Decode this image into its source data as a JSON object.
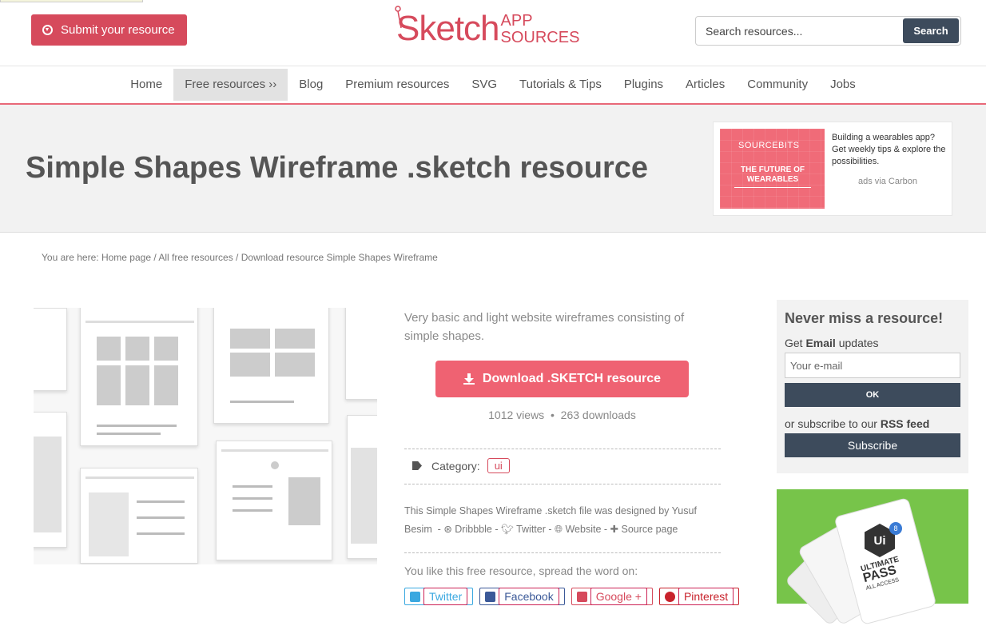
{
  "header": {
    "submit_label": "Submit your resource",
    "logo_main": "Sketch",
    "logo_app": "APP",
    "logo_sources": "SOURCES",
    "search_placeholder": "Search resources...",
    "search_button": "Search"
  },
  "nav": [
    "Home",
    "Free resources ››",
    "Blog",
    "Premium resources",
    "SVG",
    "Tutorials & Tips",
    "Plugins",
    "Articles",
    "Community",
    "Jobs"
  ],
  "hero": {
    "title": "Simple Shapes Wireframe .sketch resource",
    "ad": {
      "brand": "SOURCEBITS",
      "tagline": "THE FUTURE OF WEARABLES",
      "copy": "Building a wearables app? Get weekly tips & explore the possibilities.",
      "via": "ads via Carbon"
    }
  },
  "breadcrumb": {
    "prefix": "You are here: ",
    "home": "Home page",
    "sep1": " / ",
    "free": "All free resources",
    "sep2": " / ",
    "current": "Download resource Simple Shapes Wireframe"
  },
  "resource": {
    "description": "Very basic and light website wireframes consisting of simple shapes.",
    "download_label": "Download .SKETCH resource",
    "views": "1012 views",
    "dot": "•",
    "downloads": "263 downloads",
    "category_label": "Category:",
    "category_value": "ui",
    "credit_text": "This Simple Shapes Wireframe .sketch file was designed by Yusuf Besim",
    "credit_dribbble": "Dribbble",
    "credit_twitter": "Twitter",
    "credit_website": "Website",
    "credit_source": "Source page",
    "share_label": "You like this free resource, spread the word on:",
    "share": {
      "twitter": "Twitter",
      "facebook": "Facebook",
      "google": "Google +",
      "pinterest": "Pinterest"
    }
  },
  "sidebar": {
    "title": "Never miss a resource!",
    "get_prefix": "Get ",
    "get_bold": "Email",
    "get_suffix": " updates",
    "email_placeholder": "Your e-mail",
    "ok_label": "OK",
    "rss_prefix": "or subscribe to our ",
    "rss_bold": "RSS feed",
    "subscribe_label": "Subscribe",
    "promo": {
      "logo": "Ui",
      "badge": "8",
      "line1": "ULTIMATE",
      "line2": "PASS",
      "line3": "ALL ACCESS"
    }
  },
  "colors": {
    "brand": "#d64a5c",
    "download": "#ef6272",
    "dark_button": "#3d4b5c",
    "promo_bg": "#77c44a"
  }
}
